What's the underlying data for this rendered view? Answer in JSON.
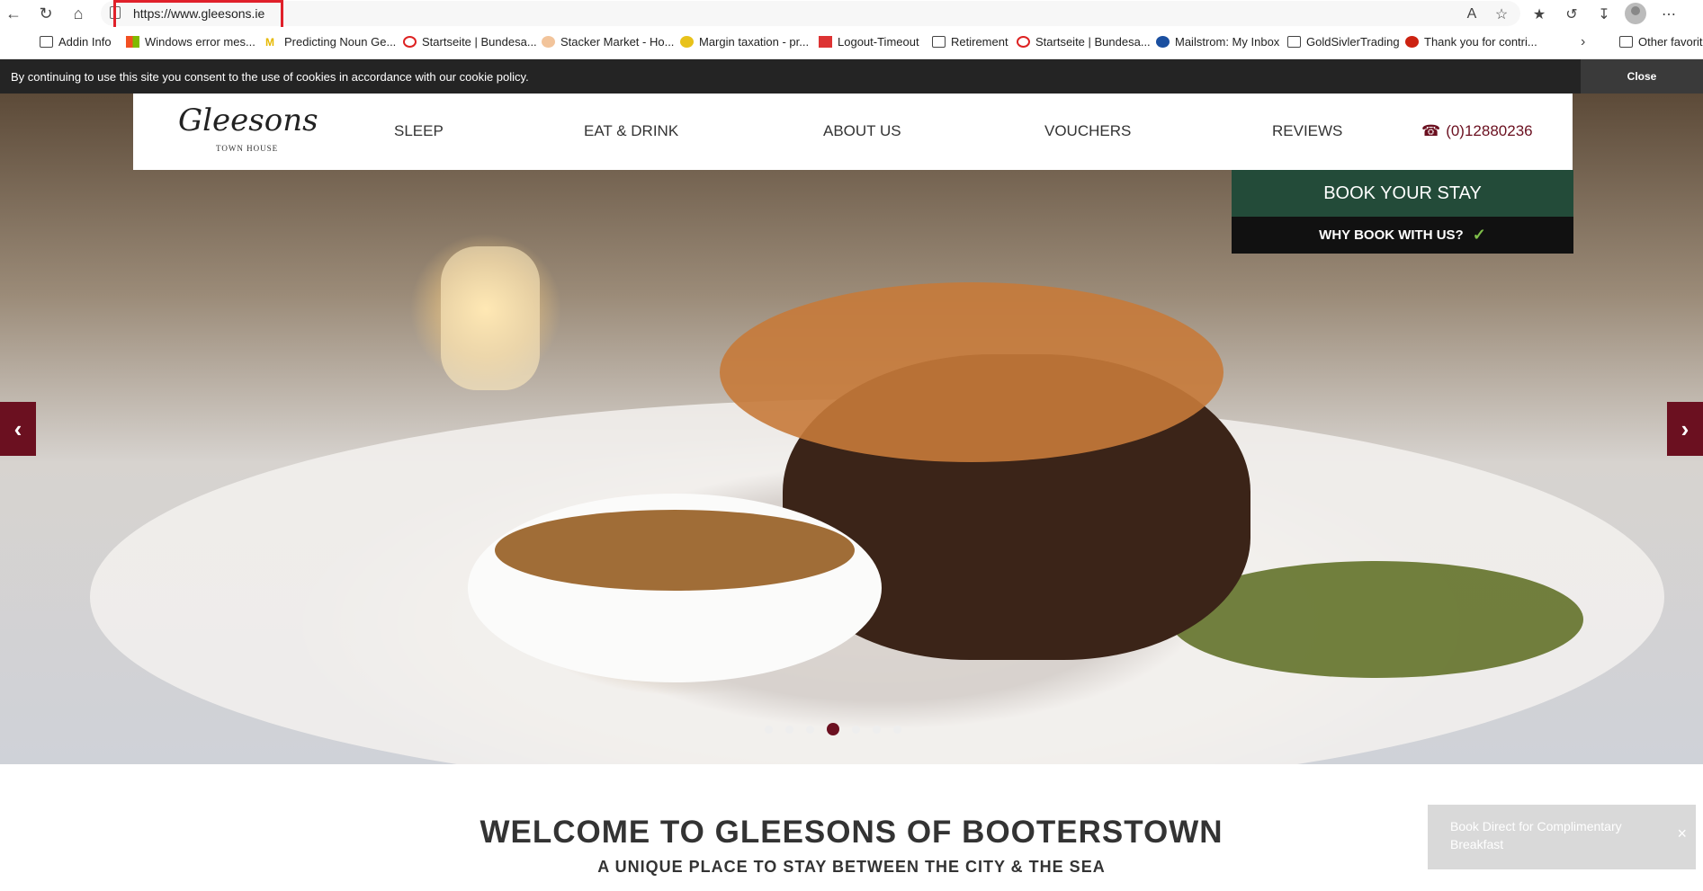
{
  "browser": {
    "url": "https://www.gleesons.ie",
    "bookmarks": [
      "Addin Info",
      "Windows error mes...",
      "Predicting Noun Ge...",
      "Startseite | Bundesa...",
      "Stacker Market - Ho...",
      "Margin taxation - pr...",
      "Logout-Timeout",
      "Retirement",
      "Startseite | Bundesa...",
      "Mailstrom: My Inbox",
      "GoldSivlerTrading",
      "Thank you for contri...",
      "Other favorites"
    ]
  },
  "cookie": {
    "message": "By continuing to use this site you consent to the use of cookies in accordance with our cookie policy.",
    "close_label": "Close"
  },
  "logo": {
    "script": "Gleesons",
    "sub": "TOWN HOUSE"
  },
  "nav": {
    "items": [
      "SLEEP",
      "EAT & DRINK",
      "ABOUT US",
      "VOUCHERS",
      "REVIEWS"
    ],
    "phone": "(0)12880236"
  },
  "cta": {
    "book": "BOOK YOUR STAY",
    "why": "WHY BOOK WITH US?"
  },
  "slider": {
    "total": 7,
    "active_index": 3
  },
  "content": {
    "welcome": "WELCOME TO GLEESONS OF BOOTERSTOWN",
    "tagline": "A UNIQUE PLACE TO STAY BETWEEN THE CITY & THE SEA"
  },
  "toast": {
    "text": "Book Direct for Complimentary Breakfast",
    "close": "×"
  },
  "colors": {
    "accent": "#6b1020",
    "book_green": "#234b39",
    "cookie_bar": "#242424"
  },
  "icons": [
    "back-icon",
    "refresh-icon",
    "home-icon",
    "lock-icon",
    "read-aloud-icon",
    "favorite-star-icon",
    "favorites-icon",
    "history-icon",
    "download-icon",
    "more-icon",
    "phone-icon",
    "check-icon",
    "chevron-left-icon",
    "chevron-right-icon"
  ]
}
